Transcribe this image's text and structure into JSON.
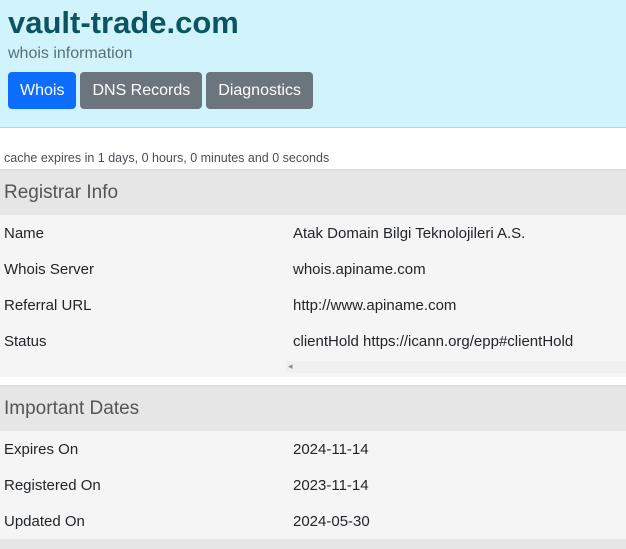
{
  "header": {
    "domain": "vault-trade.com",
    "subtitle": "whois information",
    "tabs": [
      {
        "label": "Whois",
        "active": true
      },
      {
        "label": "DNS Records",
        "active": false
      },
      {
        "label": "Diagnostics",
        "active": false
      }
    ]
  },
  "cache_note": "cache expires in 1 days, 0 hours, 0 minutes and 0 seconds",
  "registrar": {
    "heading": "Registrar Info",
    "rows": [
      {
        "key": "Name",
        "value": "Atak Domain Bilgi Teknolojileri A.S."
      },
      {
        "key": "Whois Server",
        "value": "whois.apiname.com"
      },
      {
        "key": "Referral URL",
        "value": "http://www.apiname.com"
      },
      {
        "key": "Status",
        "value": "clientHold https://icann.org/epp#clientHold"
      }
    ]
  },
  "dates": {
    "heading": "Important Dates",
    "rows": [
      {
        "key": "Expires On",
        "value": "2024-11-14"
      },
      {
        "key": "Registered On",
        "value": "2023-11-14"
      },
      {
        "key": "Updated On",
        "value": "2024-05-30"
      }
    ]
  },
  "icons": {
    "scroll_left": "chevron-left-icon"
  },
  "colors": {
    "header_bg": "#d1f3fb",
    "active_tab": "#0d6efd",
    "inactive_tab": "#6c757d",
    "title": "#0b5563"
  }
}
